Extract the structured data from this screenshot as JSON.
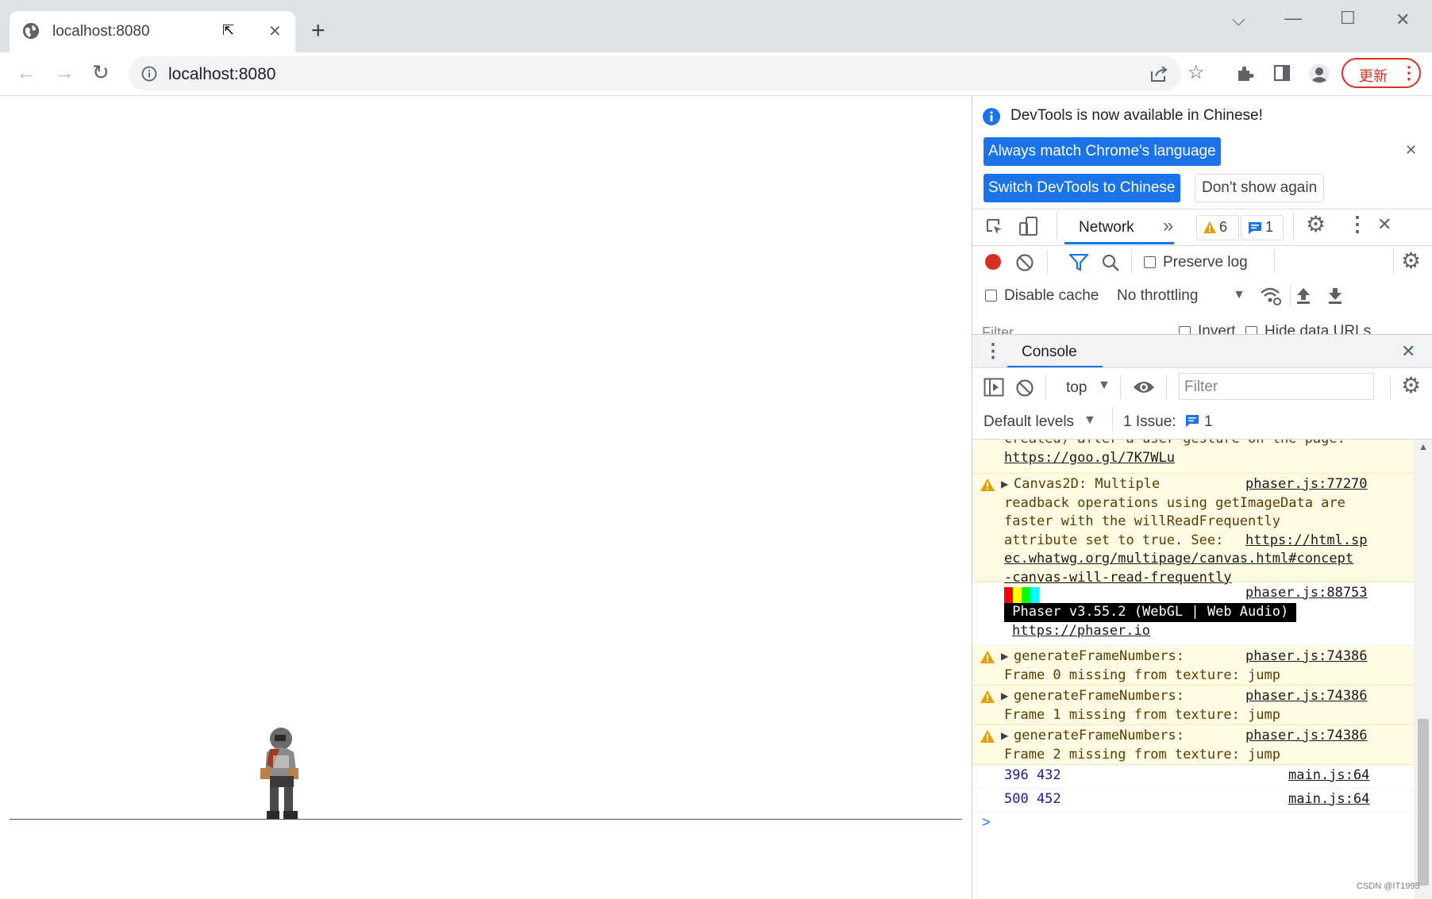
{
  "browser": {
    "tab_title": "localhost:8080",
    "tab_close": "✕",
    "new_tab": "+",
    "url": "localhost:8080",
    "update_label": "更新",
    "window": {
      "collapse": "⌵",
      "minimize": "—",
      "maximize": "☐",
      "close": "✕"
    }
  },
  "devtools": {
    "banner": {
      "message": "DevTools is now available in Chinese!",
      "btn_match": "Always match Chrome's language",
      "btn_switch": "Switch DevTools to Chinese",
      "btn_dont_show": "Don't show again",
      "close": "✕"
    },
    "tabs": {
      "active": "Network",
      "more": "»",
      "warn_count": "6",
      "msg_count": "1",
      "close": "✕"
    },
    "network": {
      "preserve_log": "Preserve log",
      "disable_cache": "Disable cache",
      "throttling": "No throttling",
      "filter_placeholder": "Filter",
      "invert": "Invert",
      "hide_data_urls": "Hide data URLs"
    },
    "console_drawer": {
      "title": "Console",
      "close": "✕",
      "context": "top",
      "filter_placeholder": "Filter",
      "levels": "Default levels",
      "issues_label": "1 Issue:",
      "issues_count": "1",
      "messages": {
        "m0_line1": "created) after a user gesture on the page.",
        "m0_link": "https://goo.gl/7K7WLu",
        "m1_text1": "Canvas2D: Multiple",
        "m1_source": "phaser.js:77270",
        "m1_text2": "readback operations using getImageData are",
        "m1_text3": "faster with the willReadFrequently",
        "m1_text4": "attribute set to true. See: ",
        "m1_link1": "https://html.sp",
        "m1_link2": "ec.whatwg.org/multipage/canvas.html#concept",
        "m1_link3": "-canvas-will-read-frequently",
        "m2_source": "phaser.js:88753",
        "m2_banner": " Phaser v3.55.2 (WebGL | Web Audio) ",
        "m2_link": "https://phaser.io",
        "m3_text1": "generateFrameNumbers:",
        "m3_source": "phaser.js:74386",
        "m3_text2": "Frame 0 missing from texture: jump",
        "m4_text1": "generateFrameNumbers:",
        "m4_source": "phaser.js:74386",
        "m4_text2": "Frame 1 missing from texture: jump",
        "m5_text1": "generateFrameNumbers:",
        "m5_source": "phaser.js:74386",
        "m5_text2": "Frame 2 missing from texture: jump",
        "m6_value": "396 432",
        "m6_source": "main.js:64",
        "m7_value": "500 452",
        "m7_source": "main.js:64",
        "prompt": ">"
      }
    }
  },
  "watermark": "CSDN @IT1995",
  "colors": {
    "accent": "#1a73e8",
    "warn_bg": "#fffbe5",
    "record": "#d93025"
  }
}
